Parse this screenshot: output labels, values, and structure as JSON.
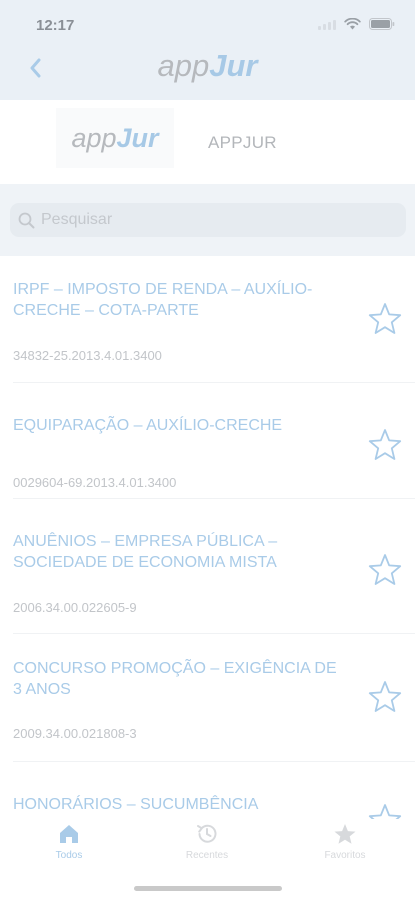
{
  "status": {
    "time": "12:17"
  },
  "nav": {
    "logo_app": "app",
    "logo_jur": "Jur"
  },
  "brand": {
    "logo_app": "app",
    "logo_jur": "Jur",
    "label": "APPJUR"
  },
  "search": {
    "placeholder": "Pesquisar"
  },
  "items": [
    {
      "title": "IRPF – IMPOSTO DE RENDA – AUXÍLIO-CRECHE – COTA-PARTE",
      "number": "34832-25.2013.4.01.3400"
    },
    {
      "title": "EQUIPARAÇÃO – AUXÍLIO-CRECHE",
      "number": "0029604-69.2013.4.01.3400"
    },
    {
      "title": "ANUÊNIOS – EMPRESA PÚBLICA – SOCIEDADE DE ECONOMIA MISTA",
      "number": "2006.34.00.022605-9"
    },
    {
      "title": "CONCURSO PROMOÇÃO – EXIGÊNCIA DE 3 ANOS",
      "number": "2009.34.00.021808-3"
    },
    {
      "title": "HONORÁRIOS – SUCUMBÊNCIA",
      "number": ""
    }
  ],
  "tabs": [
    {
      "label": "Todos",
      "icon": "home-icon",
      "active": true
    },
    {
      "label": "Recentes",
      "icon": "history-icon",
      "active": false
    },
    {
      "label": "Favoritos",
      "icon": "star-icon",
      "active": false
    }
  ],
  "colors": {
    "accent": "#a9cbe8",
    "header_bg": "#eaf0f6"
  }
}
